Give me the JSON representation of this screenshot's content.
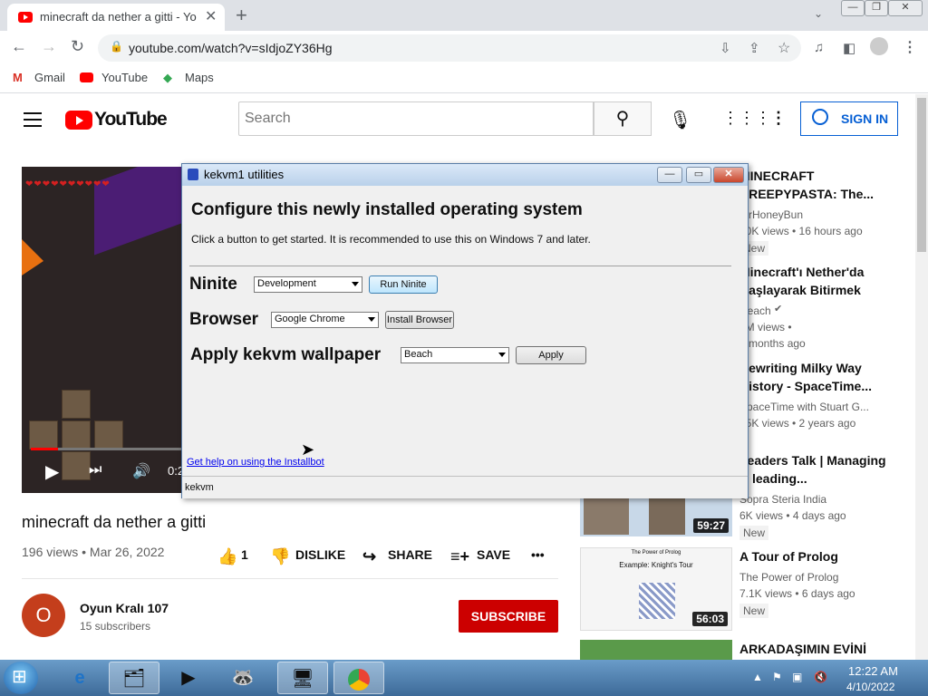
{
  "browser": {
    "tab_title": "minecraft da nether a gitti - Yo",
    "url": "youtube.com/watch?v=sIdjoZY36Hg",
    "bookmarks": [
      "Gmail",
      "YouTube",
      "Maps"
    ]
  },
  "youtube": {
    "logo": "YouTube",
    "search_placeholder": "Search",
    "sign_in": "SIGN IN",
    "player": {
      "time": "0:2"
    },
    "video": {
      "title": "minecraft da nether a gitti",
      "views_date": "196 views • Mar 26, 2022",
      "likes": "1",
      "dislike": "DISLIKE",
      "share": "SHARE",
      "save": "SAVE"
    },
    "channel": {
      "avatar_letter": "O",
      "name": "Oyun Kralı 107",
      "subscribers": "15 subscribers",
      "subscribe": "SUBSCRIBE"
    },
    "recommendations": [
      {
        "title": "MINECRAFT CREEPYPASTA: The...",
        "channel": "MrHoneyBun",
        "meta": "10K views • 16 hours ago",
        "badge": "New"
      },
      {
        "title": "Minecraft'ı Nether'da Başlayarak Bitirmek",
        "channel": "Reach",
        "meta": "2M views •",
        "meta2": "1 months ago"
      },
      {
        "title": "Rewriting Milky Way History - SpaceTime...",
        "channel": "SpaceTime with Stuart G...",
        "meta": "15K views • 2 years ago"
      },
      {
        "title": "Leaders Talk | Managing & leading...",
        "channel": "Sopra Steria India",
        "meta": "6K views • 4 days ago",
        "badge": "New",
        "duration": "59:27"
      },
      {
        "title": "A Tour of Prolog",
        "channel": "The Power of Prolog",
        "meta": "7.1K views • 6 days ago",
        "badge": "New",
        "duration": "56:03",
        "thumb_text": "The Power of Prolog",
        "thumb_sub": "Example: Knight's Tour"
      },
      {
        "title": "ARKADAŞIMIN EVİNİ"
      }
    ]
  },
  "dialog": {
    "title": "kekvm1 utilities",
    "heading": "Configure this newly installed operating system",
    "instructions": "Click a button to get started. It is recommended to use this on Windows 7 and later.",
    "ninite": {
      "label": "Ninite",
      "selected": "Development",
      "button": "Run Ninite"
    },
    "browser": {
      "label": "Browser",
      "selected": "Google Chrome",
      "button": "Install Browser"
    },
    "wallpaper": {
      "label": "Apply kekvm wallpaper",
      "selected": "Beach",
      "button": "Apply"
    },
    "help_link": "Get help on using the Installbot",
    "status": "kekvm"
  },
  "taskbar": {
    "time": "12:22 AM",
    "date": "4/10/2022"
  }
}
